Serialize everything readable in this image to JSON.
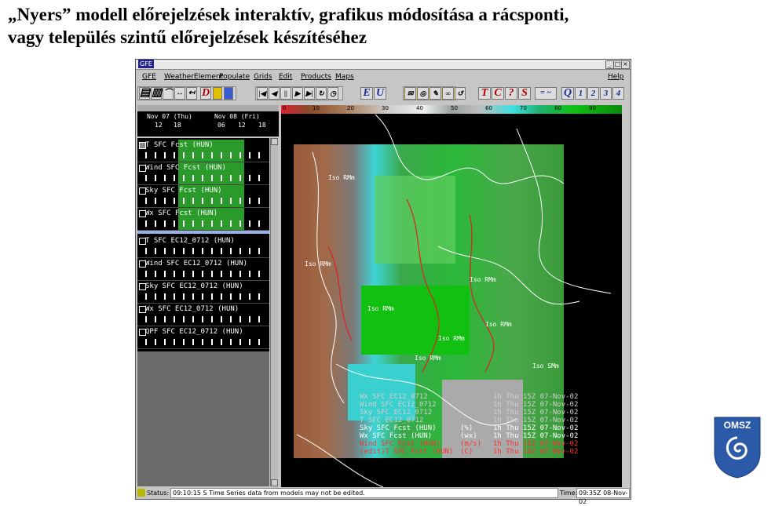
{
  "slide": {
    "title_line1": "„Nyers”  modell előrejelzések interaktív, grafikus módosítása a rácsponti,",
    "title_line2": "vagy település szintű előrejelzések készítéséhez"
  },
  "window": {
    "title": "GFE",
    "menu": [
      "GFE",
      "WeatherElement",
      "Populate",
      "Grids",
      "Edit",
      "Products",
      "Maps"
    ],
    "help": "Help"
  },
  "toolbar": {
    "letters": [
      "D",
      "E",
      "U",
      "T",
      "C",
      "?",
      "S",
      "Q",
      "1",
      "2",
      "3",
      "4"
    ],
    "eq_label": "= ~"
  },
  "timeline": {
    "day1": "Nov 07 (Thu)",
    "day2": "Nov 08 (Fri)",
    "hours": [
      "12",
      "18",
      "06",
      "12",
      "18"
    ]
  },
  "grid_manager": {
    "rows": [
      {
        "label": "T  SFC  Fcst (HUN)",
        "checked": true
      },
      {
        "label": "Wind SFC  Fcst (HUN)",
        "checked": false
      },
      {
        "label": "Sky  SFC  Fcst (HUN)",
        "checked": false
      },
      {
        "label": "Wx  SFC  Fcst (HUN)",
        "checked": false
      },
      {
        "label": "T  SFC  EC12_0712 (HUN)",
        "checked": false
      },
      {
        "label": "Wind SFC  EC12_0712 (HUN)",
        "checked": false
      },
      {
        "label": "Sky  SFC  EC12_0712 (HUN)",
        "checked": false
      },
      {
        "label": "Wx  SFC  EC12_0712 (HUN)",
        "checked": false
      },
      {
        "label": "QPF  SFC  EC12_0712 (HUN)",
        "checked": false
      }
    ]
  },
  "colorbar": {
    "ticks": [
      "0",
      "10",
      "20",
      "30",
      "40",
      "50",
      "60",
      "70",
      "80",
      "90"
    ]
  },
  "map": {
    "labels": [
      "Iso RMm",
      "Iso RMm",
      "Iso RMm",
      "Iso RMm",
      "Iso RMm",
      "Iso RMm",
      "Iso RMm",
      "Iso SMm"
    ],
    "legend": [
      {
        "name": "Wx  SFC EC12_0712",
        "units": "",
        "time": "1h Thu 15Z 07-Nov-02",
        "color": "#d0d0d0"
      },
      {
        "name": "Wind SFC EC12_0712",
        "units": "",
        "time": "1h Thu 15Z 07-Nov-02",
        "color": "#d0d0d0"
      },
      {
        "name": "Sky  SFC EC12_0712",
        "units": "",
        "time": "1h Thu 15Z 07-Nov-02",
        "color": "#d0d0d0"
      },
      {
        "name": "T  SFC EC12_0712",
        "units": "",
        "time": "1h Thu 15Z 07-Nov-02",
        "color": "#d0d0d0"
      },
      {
        "name": "Sky SFC Fcst (HUN)",
        "units": "(%)",
        "time": "1h Thu 15Z 07-Nov-02",
        "color": "#ffffff"
      },
      {
        "name": "Wx   SFC Fcst (HUN)",
        "units": "(wx)",
        "time": "1h Thu 15Z 07-Nov-02",
        "color": "#ffffff"
      },
      {
        "name": "Wind SFC Fcst (HUN)",
        "units": "(m/s)",
        "time": "1h Thu 15Z 07-Nov-02",
        "color": "#ff3030"
      },
      {
        "name": "(edit)T  SFC Fcst (HUN)",
        "units": "(C)",
        "time": "1h Thu 15Z 07-Nov-02",
        "color": "#ff3030"
      }
    ]
  },
  "status": {
    "label": "Status:",
    "message": "09:10:15 S Time Series data from models may not be edited.",
    "time_label": "Time:",
    "time_value": "09:35Z 08-Nov-02"
  },
  "logo": {
    "text": "OMSZ"
  },
  "colors": {
    "accent": "#23238a",
    "field_green": "#2bb83a",
    "field_cyan": "#3fd5d5"
  }
}
